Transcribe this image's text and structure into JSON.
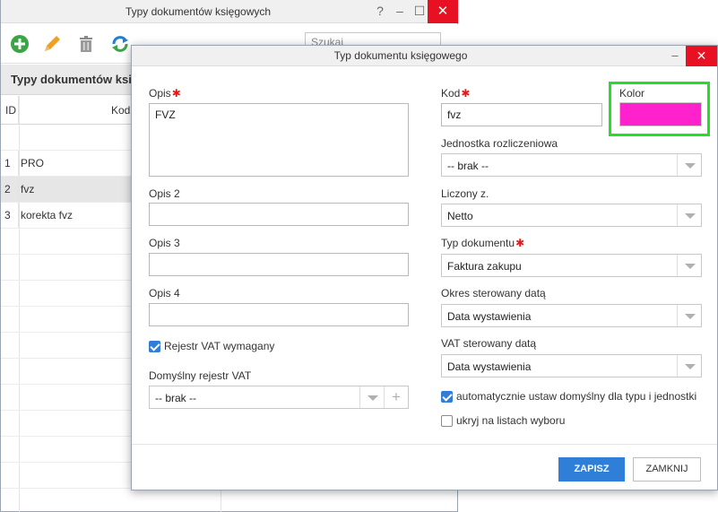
{
  "background_window": {
    "title": "Typy dokumentów księgowych",
    "help": "?",
    "minimize": "–",
    "maximize": "☐",
    "close": "✕",
    "search_placeholder": "Szukaj",
    "subheader_title": "Typy dokumentów księg",
    "grid": {
      "headers": {
        "id": "ID",
        "kod": "Kod"
      },
      "rows": [
        {
          "id": "1",
          "name": "PRO"
        },
        {
          "id": "2",
          "name": "fvz"
        },
        {
          "id": "3",
          "name": "korekta fvz"
        }
      ]
    }
  },
  "dialog": {
    "title": "Typ dokumentu księgowego",
    "minimize": "–",
    "close": "✕",
    "opis": {
      "label": "Opis",
      "required": "✱",
      "value": "FVZ"
    },
    "opis2": {
      "label": "Opis 2",
      "value": ""
    },
    "opis3": {
      "label": "Opis 3",
      "value": ""
    },
    "opis4": {
      "label": "Opis 4",
      "value": ""
    },
    "rejestr_vat_wymagany": {
      "label": "Rejestr VAT wymagany",
      "checked": true
    },
    "domyslny_rejestr_vat": {
      "label": "Domyślny rejestr VAT",
      "value": "-- brak --",
      "add": "+"
    },
    "kod": {
      "label": "Kod",
      "required": "✱",
      "value": "fvz"
    },
    "kolor": {
      "label": "Kolor",
      "value": "#ff22cc"
    },
    "jednostka": {
      "label": "Jednostka rozliczeniowa",
      "value": "-- brak --"
    },
    "liczony_z": {
      "label": "Liczony z.",
      "value": "Netto"
    },
    "typ_dokumentu": {
      "label": "Typ dokumentu",
      "required": "✱",
      "value": "Faktura zakupu"
    },
    "okres_sterowany": {
      "label": "Okres sterowany datą",
      "value": "Data wystawienia"
    },
    "vat_sterowany": {
      "label": "VAT sterowany datą",
      "value": "Data wystawienia"
    },
    "auto_domyslny": {
      "label": "automatycznie ustaw domyślny dla typu i jednostki",
      "checked": true
    },
    "ukryj": {
      "label": "ukryj na listach wyboru",
      "checked": false
    },
    "buttons": {
      "save": "ZAPISZ",
      "close": "ZAMKNIJ"
    }
  },
  "colors": {
    "accent": "#2f7ed8",
    "close_red": "#e81123",
    "highlight_green": "#22e02a",
    "required_red": "#e01b1b"
  }
}
